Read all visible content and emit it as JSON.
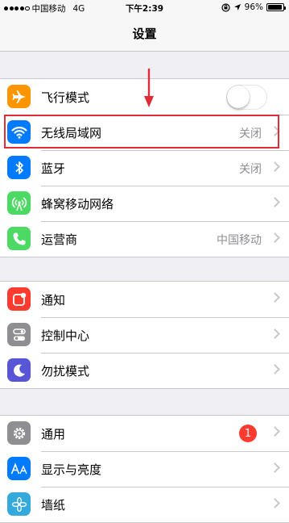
{
  "status_bar": {
    "carrier": "中国移动",
    "network": "4G",
    "time": "下午2:39",
    "battery": "96%",
    "battery_level": 0.96
  },
  "nav": {
    "title": "设置"
  },
  "colors": {
    "airplane": "#ff9500",
    "wifi": "#007aff",
    "bluetooth": "#007aff",
    "cellular": "#4cd964",
    "carrier": "#4cd964",
    "notifications": "#ff3b30",
    "control_center": "#8e8e93",
    "dnd": "#5856d6",
    "general": "#8e8e93",
    "display": "#007aff",
    "wallpaper": "#34aadc",
    "highlight": "#e02b38"
  },
  "groups": [
    {
      "items": [
        {
          "label": "飞行模式",
          "icon": "airplane-icon",
          "toggle": false
        },
        {
          "label": "无线局域网",
          "icon": "wifi-icon",
          "detail": "关闭"
        },
        {
          "label": "蓝牙",
          "icon": "bluetooth-icon",
          "detail": "关闭"
        },
        {
          "label": "蜂窝移动网络",
          "icon": "cellular-icon"
        },
        {
          "label": "运营商",
          "icon": "phone-icon",
          "detail": "中国移动"
        }
      ]
    },
    {
      "items": [
        {
          "label": "通知",
          "icon": "notifications-icon"
        },
        {
          "label": "控制中心",
          "icon": "control-center-icon"
        },
        {
          "label": "勿扰模式",
          "icon": "moon-icon"
        }
      ]
    },
    {
      "items": [
        {
          "label": "通用",
          "icon": "gear-icon",
          "badge": "1"
        },
        {
          "label": "显示与亮度",
          "icon": "display-icon"
        },
        {
          "label": "墙纸",
          "icon": "wallpaper-icon"
        }
      ]
    }
  ]
}
